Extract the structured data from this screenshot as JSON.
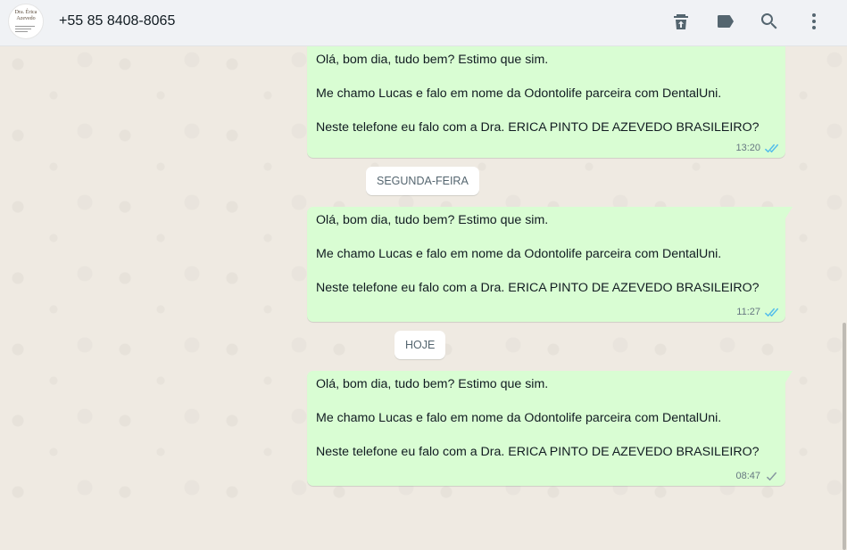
{
  "header": {
    "avatar_text": "Dra. Érica\nAzevedo",
    "contact": "+55 85 8408-8065",
    "icons": [
      "archive-icon",
      "label-icon",
      "search-icon",
      "menu-icon"
    ]
  },
  "messages": [
    {
      "lines": [
        "Olá, bom dia, tudo bem? Estimo que sim.",
        "Me chamo Lucas e falo em nome da Odontolife parceira com DentalUni.",
        "Neste telefone eu falo com a Dra.  ERICA PINTO DE AZEVEDO BRASILEIRO?"
      ],
      "time": "13:20",
      "status": "read"
    },
    {
      "lines": [
        "Olá, bom dia, tudo bem? Estimo que sim.",
        "Me chamo Lucas e falo em nome da Odontolife parceira com DentalUni.",
        "Neste telefone eu falo com a Dra.  ERICA PINTO DE AZEVEDO BRASILEIRO?"
      ],
      "time": "11:27",
      "status": "read"
    },
    {
      "lines": [
        "Olá, bom dia, tudo bem? Estimo que sim.",
        "Me chamo Lucas e falo em nome da Odontolife parceira com DentalUni.",
        "Neste telefone eu falo com a Dra.  ERICA PINTO DE AZEVEDO BRASILEIRO?"
      ],
      "time": "08:47",
      "status": "delivered"
    }
  ],
  "date_separators": [
    "SEGUNDA-FEIRA",
    "HOJE"
  ],
  "colors": {
    "bubble_out": "#d9fdd3",
    "read_ticks": "#53bdeb",
    "delivered_ticks": "#8696a0",
    "header_bg": "#f0f2f5"
  }
}
